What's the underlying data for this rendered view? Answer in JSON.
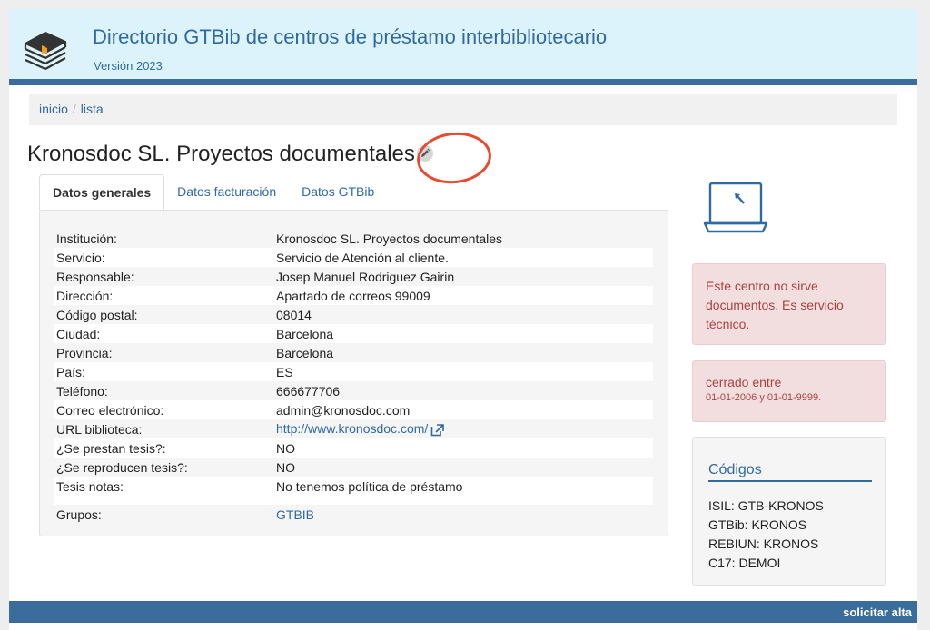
{
  "header": {
    "title": "Directorio GTBib de centros de préstamo interbibliotecario",
    "version": "Versión 2023"
  },
  "breadcrumb": {
    "items": [
      "inicio",
      "lista"
    ],
    "separator": "/"
  },
  "page_title": "Kronosdoc SL. Proyectos documentales",
  "tabs": [
    {
      "label": "Datos generales",
      "active": true
    },
    {
      "label": "Datos facturación",
      "active": false
    },
    {
      "label": "Datos GTBib",
      "active": false
    }
  ],
  "info": [
    {
      "label": "Institución:",
      "value": "Kronosdoc SL. Proyectos documentales"
    },
    {
      "label": "Servicio:",
      "value": "Servicio de Atención al cliente."
    },
    {
      "label": "Responsable:",
      "value": "Josep Manuel Rodriguez Gairin"
    },
    {
      "label": "Dirección:",
      "value": "Apartado de correos 99009"
    },
    {
      "label": "Código postal:",
      "value": "08014"
    },
    {
      "label": "Ciudad:",
      "value": "Barcelona"
    },
    {
      "label": "Provincia:",
      "value": "Barcelona"
    },
    {
      "label": "País:",
      "value": "ES"
    },
    {
      "label": "Teléfono:",
      "value": "666677706"
    },
    {
      "label": "Correo electrónico:",
      "value": "admin@kronosdoc.com"
    },
    {
      "label": "URL biblioteca:",
      "value": "http://www.kronosdoc.com/"
    },
    {
      "label": "¿Se prestan tesis?:",
      "value": "NO"
    },
    {
      "label": "¿Se reproducen tesis?:",
      "value": "NO"
    },
    {
      "label": "Tesis notas:",
      "value": "No tenemos política de préstamo"
    },
    {
      "label": "Grupos:",
      "value": "GTBIB"
    }
  ],
  "alerts": {
    "no_service": "Este centro no sirve documentos. Es servicio técnico.",
    "closed_label": "cerrado entre",
    "closed_dates": "01-01-2006 y 01-01-9999."
  },
  "codes": {
    "title": "Códigos",
    "items": [
      "ISIL: GTB-KRONOS",
      "GTBib: KRONOS",
      "REBIUN: KRONOS",
      "C17: DEMOI"
    ]
  },
  "footer": {
    "signup_label": "solicitar alta"
  },
  "colors": {
    "accent": "#2f6aa3",
    "header_bg": "#dcf3fc",
    "header_bar": "#3a6c9c",
    "alert_bg": "#f2dede",
    "alert_text": "#a94442",
    "annotation_circle": "#e8492f"
  },
  "icons": [
    "books-logo-icon",
    "pencil-icon",
    "external-link-icon",
    "laptop-icon"
  ]
}
